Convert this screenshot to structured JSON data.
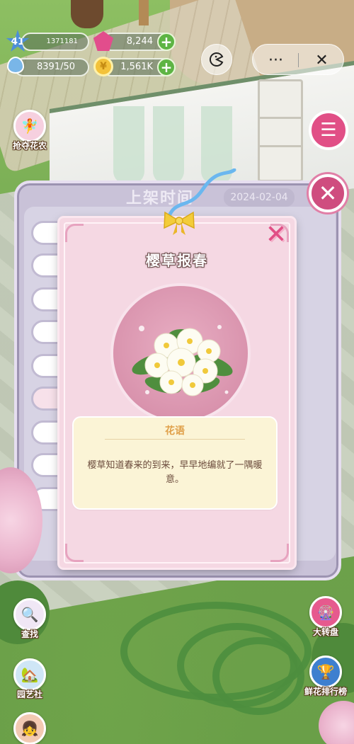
{
  "hud": {
    "level": "41",
    "experience": "1371181",
    "gems": "8,244",
    "water": "8391/50",
    "coins": "1,561K",
    "coin_symbol": "¥"
  },
  "system": {
    "game_center_icon": "pacman-face",
    "more_label": "···",
    "close_label": "✕"
  },
  "left_menu": {
    "top_item": "抢夺花农",
    "bottom_items": [
      "查找",
      "园艺社"
    ]
  },
  "right_menu": {
    "list_icon": "list-icon",
    "bottom_items": [
      "大转盘",
      "鲜花排行榜"
    ]
  },
  "shop": {
    "title": "上架时间",
    "date": "2024-02-04",
    "close_label": "✕"
  },
  "modal": {
    "title": "樱草报春",
    "close_label": "✕",
    "flower_language_title": "花语",
    "flower_language_text": "樱草知道春来的到来，早早地编就了一隅暖意。"
  },
  "colors": {
    "accent_pink": "#e14f86",
    "card_pink": "#f5d8e3",
    "note_cream": "#fbf4d6",
    "note_title": "#e0a04a",
    "plus_green": "#5db444"
  }
}
